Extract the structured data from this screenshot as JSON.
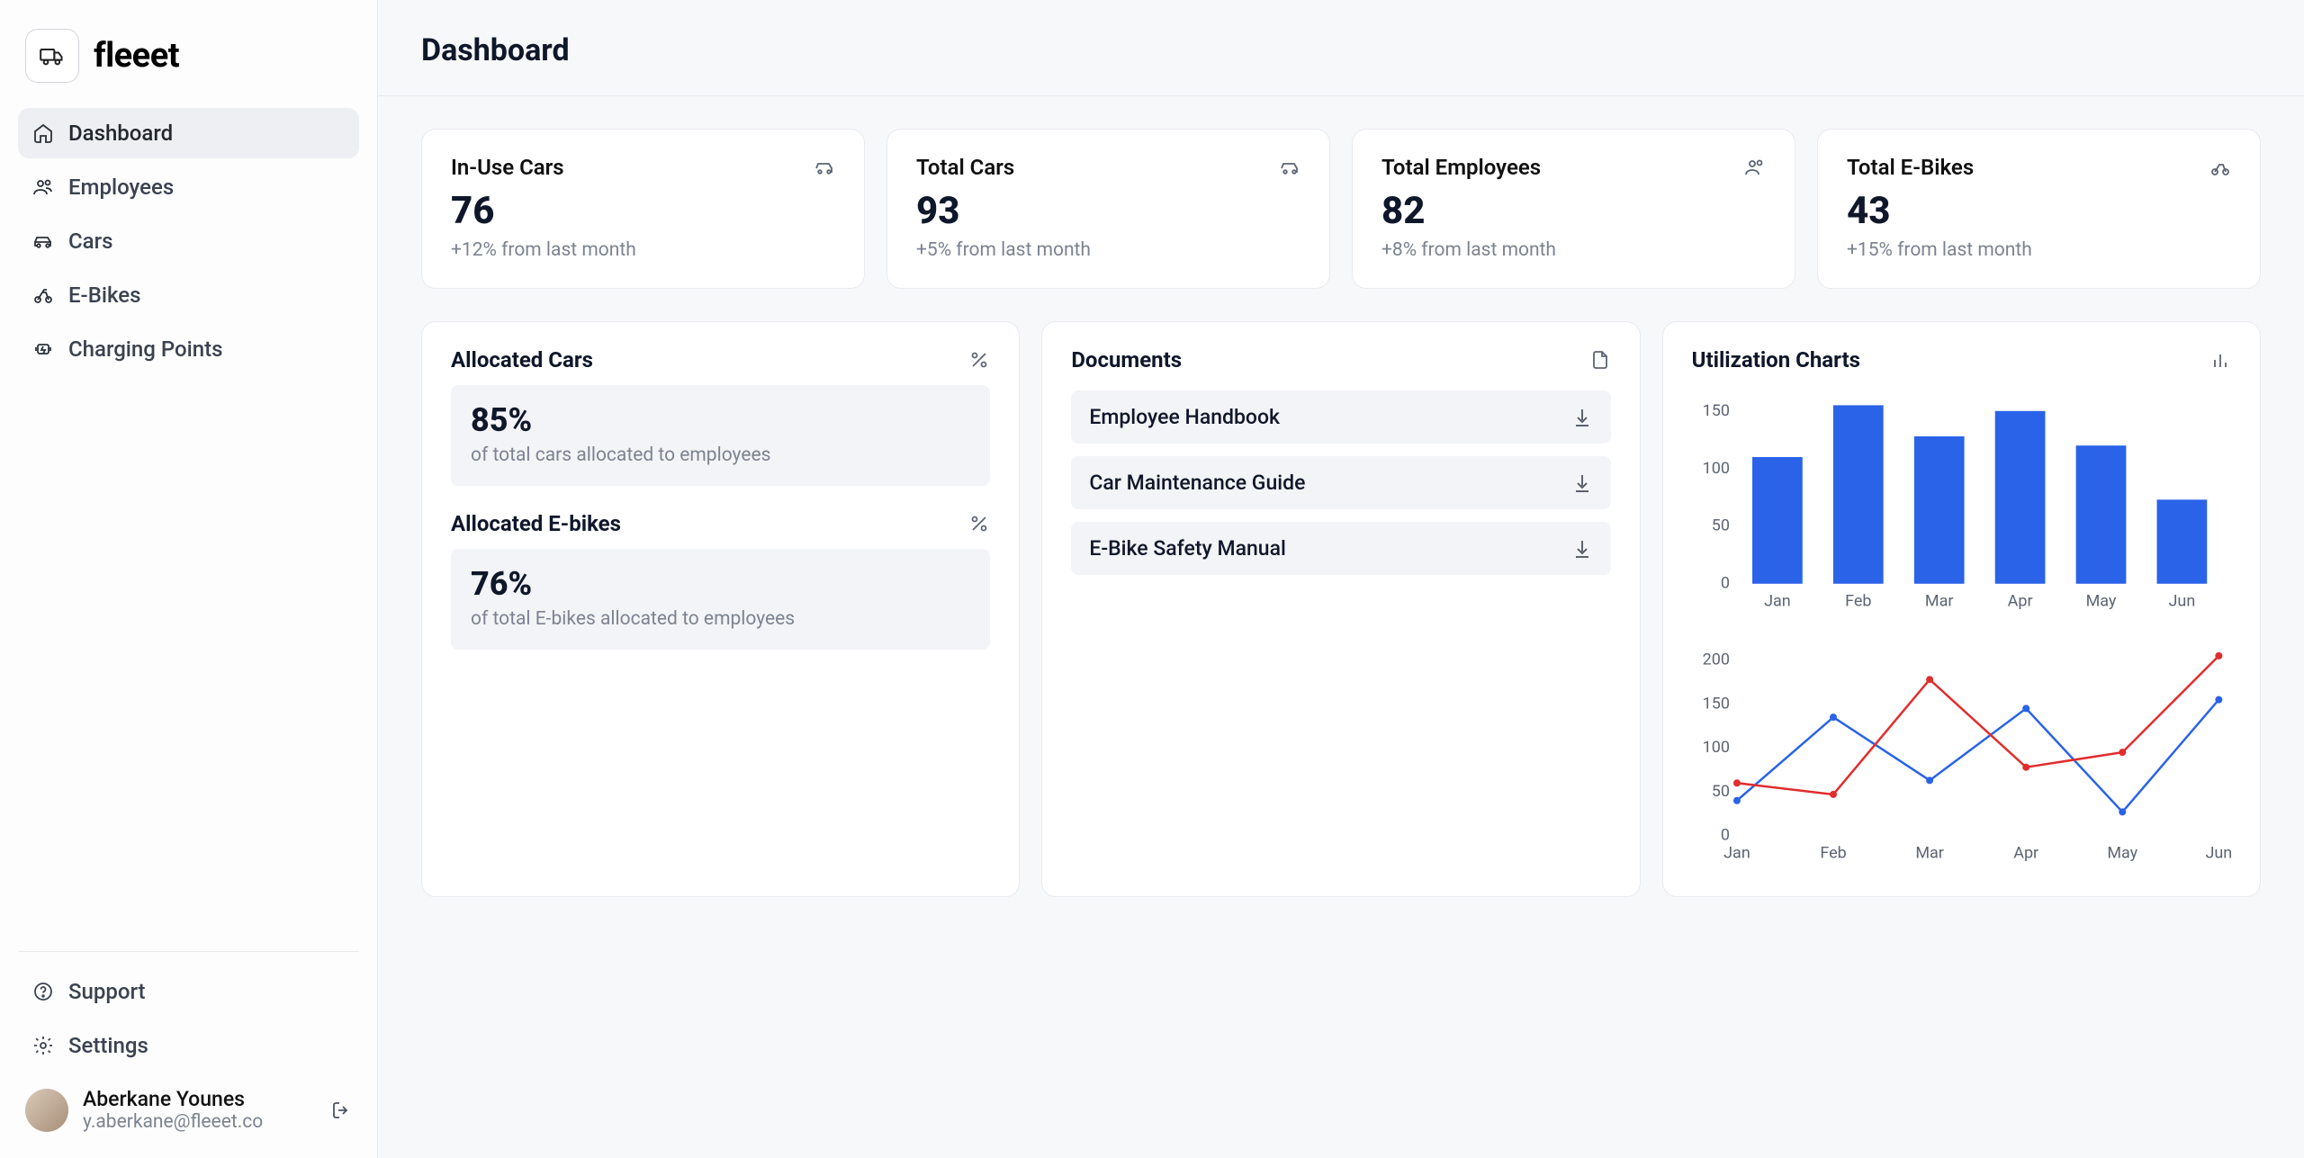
{
  "brand": {
    "name": "fleeet"
  },
  "sidebar": {
    "items": [
      {
        "label": "Dashboard"
      },
      {
        "label": "Employees"
      },
      {
        "label": "Cars"
      },
      {
        "label": "E-Bikes"
      },
      {
        "label": "Charging Points"
      }
    ],
    "support": "Support",
    "settings": "Settings"
  },
  "user": {
    "name": "Aberkane Younes",
    "email": "y.aberkane@fleeet.co"
  },
  "page": {
    "title": "Dashboard"
  },
  "stats": [
    {
      "label": "In-Use Cars",
      "value": "76",
      "sub": "+12% from last month"
    },
    {
      "label": "Total Cars",
      "value": "93",
      "sub": "+5% from last month"
    },
    {
      "label": "Total Employees",
      "value": "82",
      "sub": "+8% from last month"
    },
    {
      "label": "Total E-Bikes",
      "value": "43",
      "sub": "+15% from last month"
    }
  ],
  "allocations": {
    "cars": {
      "title": "Allocated Cars",
      "value": "85%",
      "sub": "of total cars allocated to employees"
    },
    "ebikes": {
      "title": "Allocated E-bikes",
      "value": "76%",
      "sub": "of total E-bikes allocated to employees"
    }
  },
  "documents": {
    "title": "Documents",
    "items": [
      {
        "name": "Employee Handbook"
      },
      {
        "name": "Car Maintenance Guide"
      },
      {
        "name": "E-Bike Safety Manual"
      }
    ]
  },
  "charts": {
    "title": "Utilization Charts"
  },
  "chart_data": [
    {
      "type": "bar",
      "categories": [
        "Jan",
        "Feb",
        "Mar",
        "Apr",
        "May",
        "Jun"
      ],
      "values": [
        110,
        155,
        128,
        150,
        120,
        73
      ],
      "ylim": [
        0,
        160
      ],
      "yticks": [
        0,
        50,
        100,
        150
      ]
    },
    {
      "type": "line",
      "x": [
        "Jan",
        "Feb",
        "Mar",
        "Apr",
        "May",
        "Jun"
      ],
      "series": [
        {
          "name": "series-blue",
          "values": [
            40,
            135,
            63,
            145,
            27,
            155
          ],
          "color": "#2a63e8"
        },
        {
          "name": "series-red",
          "values": [
            60,
            47,
            178,
            78,
            95,
            205
          ],
          "color": "#e02d2d"
        }
      ],
      "ylim": [
        0,
        210
      ],
      "yticks": [
        0,
        50,
        100,
        150,
        200
      ]
    }
  ]
}
